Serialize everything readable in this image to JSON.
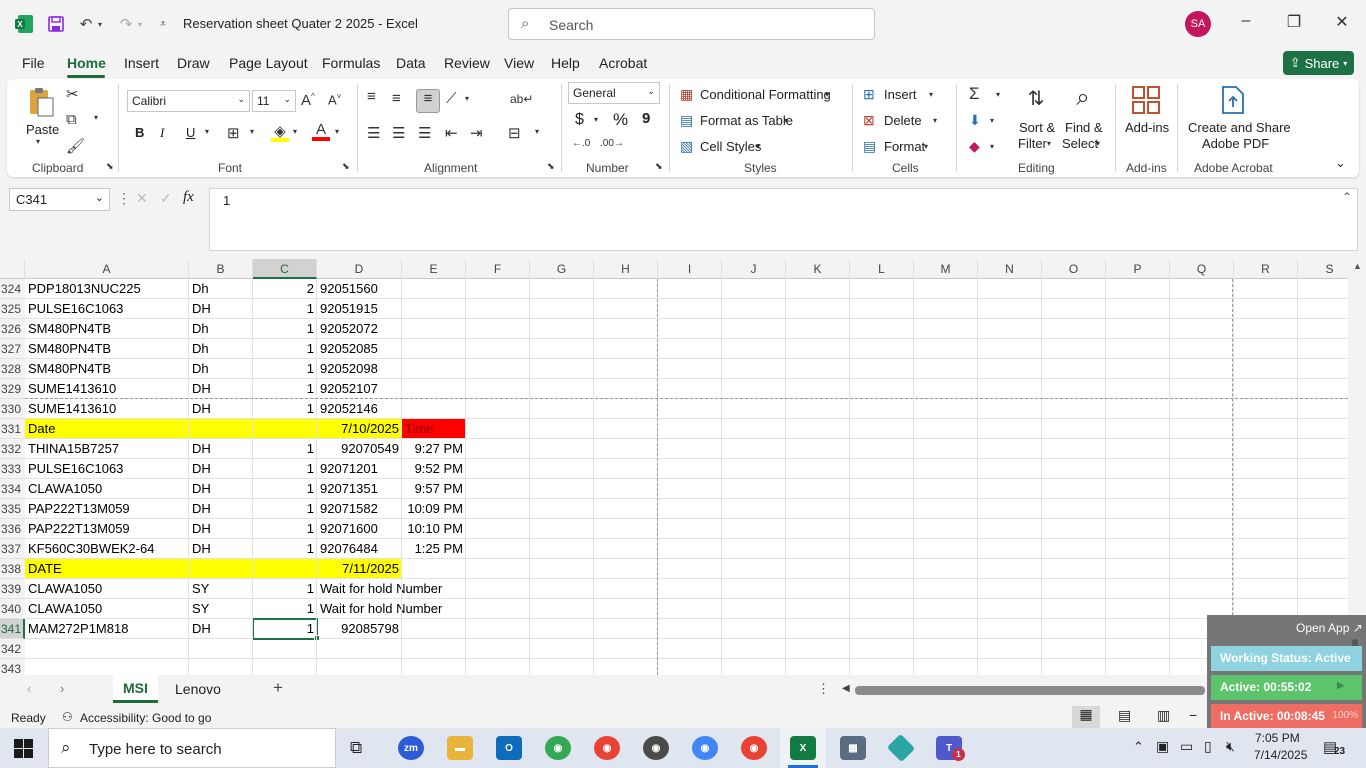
{
  "window": {
    "title": "Reservation sheet Quater 2 2025  -  Excel",
    "search_placeholder": "Search",
    "avatar_initials": "SA"
  },
  "menu": {
    "tabs": [
      "File",
      "Home",
      "Insert",
      "Draw",
      "Page Layout",
      "Formulas",
      "Data",
      "Review",
      "View",
      "Help",
      "Acrobat"
    ],
    "share_label": "Share"
  },
  "ribbon": {
    "clipboard": {
      "label": "Clipboard",
      "paste": "Paste"
    },
    "font": {
      "label": "Font",
      "name": "Calibri",
      "size": "11",
      "bold": "B",
      "italic": "I",
      "underline": "U"
    },
    "alignment": {
      "label": "Alignment"
    },
    "number": {
      "label": "Number",
      "format": "General",
      "currency": "$",
      "percent": "%",
      "comma": "9"
    },
    "styles": {
      "label": "Styles",
      "conditional": "Conditional Formatting",
      "table": "Format as Table",
      "cell_styles": "Cell Styles"
    },
    "cells": {
      "label": "Cells",
      "insert": "Insert",
      "delete": "Delete",
      "format": "Format"
    },
    "editing": {
      "label": "Editing",
      "sort": "Sort &",
      "filter": "Filter",
      "find": "Find &",
      "select": "Select"
    },
    "addins": {
      "label": "Add-ins",
      "button": "Add-ins"
    },
    "acrobat": {
      "label": "Adobe Acrobat",
      "button_line1": "Create and Share",
      "button_line2": "Adobe PDF"
    }
  },
  "formula_bar": {
    "name_box": "C341",
    "fx": "fx",
    "value": "1"
  },
  "columns": [
    "A",
    "B",
    "C",
    "D",
    "E",
    "F",
    "G",
    "H",
    "I",
    "J",
    "K",
    "L",
    "M",
    "N",
    "O",
    "P",
    "Q",
    "R",
    "S"
  ],
  "rows": [
    {
      "n": "324",
      "a": "PDP18013NUC225",
      "b": "Dh",
      "c": "2",
      "d": "92051560",
      "e": ""
    },
    {
      "n": "325",
      "a": "PULSE16C1063",
      "b": "DH",
      "c": "1",
      "d": "92051915",
      "e": ""
    },
    {
      "n": "326",
      "a": "SM480PN4TB",
      "b": "Dh",
      "c": "1",
      "d": "92052072",
      "e": ""
    },
    {
      "n": "327",
      "a": "SM480PN4TB",
      "b": "Dh",
      "c": "1",
      "d": "92052085",
      "e": ""
    },
    {
      "n": "328",
      "a": "SM480PN4TB",
      "b": "Dh",
      "c": "1",
      "d": "92052098",
      "e": ""
    },
    {
      "n": "329",
      "a": "SUME1413610",
      "b": "DH",
      "c": "1",
      "d": "92052107",
      "e": ""
    },
    {
      "n": "330",
      "a": "SUME1413610",
      "b": "DH",
      "c": "1",
      "d": "92052146",
      "e": ""
    },
    {
      "n": "331",
      "a": "Date",
      "b": "",
      "c": "",
      "d": "7/10/2025",
      "e": "Time",
      "style": "date-time"
    },
    {
      "n": "332",
      "a": "THINA15B7257",
      "b": "DH",
      "c": "1",
      "d": "92070549",
      "e": "9:27 PM",
      "dalign": "right"
    },
    {
      "n": "333",
      "a": "PULSE16C1063",
      "b": "DH",
      "c": "1",
      "d": "92071201",
      "e": "9:52 PM"
    },
    {
      "n": "334",
      "a": "CLAWA1050",
      "b": "DH",
      "c": "1",
      "d": "92071351",
      "e": "9:57 PM"
    },
    {
      "n": "335",
      "a": "PAP222T13M059",
      "b": "DH",
      "c": "1",
      "d": "92071582",
      "e": "10:09 PM"
    },
    {
      "n": "336",
      "a": "PAP222T13M059",
      "b": "DH",
      "c": "1",
      "d": "92071600",
      "e": "10:10 PM"
    },
    {
      "n": "337",
      "a": "KF560C30BWEK2-64",
      "b": "DH",
      "c": "1",
      "d": "92076484",
      "e": "1:25 PM"
    },
    {
      "n": "338",
      "a": "DATE",
      "b": "",
      "c": "",
      "d": "7/11/2025",
      "e": "",
      "style": "date"
    },
    {
      "n": "339",
      "a": "CLAWA1050",
      "b": "SY",
      "c": "1",
      "d": "Wait for hold Number",
      "e": ""
    },
    {
      "n": "340",
      "a": "CLAWA1050",
      "b": "SY",
      "c": "1",
      "d": "Wait for hold Number",
      "e": ""
    },
    {
      "n": "341",
      "a": "MAM272P1M818",
      "b": "DH",
      "c": "1",
      "d": "92085798",
      "e": "",
      "dalign": "right",
      "selected": true
    },
    {
      "n": "342",
      "a": "",
      "b": "",
      "c": "",
      "d": "",
      "e": ""
    },
    {
      "n": "343",
      "a": "",
      "b": "",
      "c": "",
      "d": "",
      "e": ""
    }
  ],
  "sheets": {
    "tabs": [
      "MSI",
      "Lenovo"
    ],
    "active": "MSI"
  },
  "status": {
    "ready": "Ready",
    "accessibility": "Accessibility: Good to go"
  },
  "widget": {
    "open_app": "Open App",
    "working_status": "Working Status: Active",
    "active": "Active: 00:55:02",
    "inactive": "In Active: 00:08:45",
    "inactive_pct": "100%"
  },
  "taskbar": {
    "search_placeholder": "Type here to search",
    "time": "7:05 PM",
    "date": "7/14/2025",
    "notifications": "23",
    "teams_badge": "1"
  },
  "colors": {
    "excel_green": "#1e7145",
    "highlight_yellow": "#ffff00",
    "highlight_red": "#ff0000"
  }
}
